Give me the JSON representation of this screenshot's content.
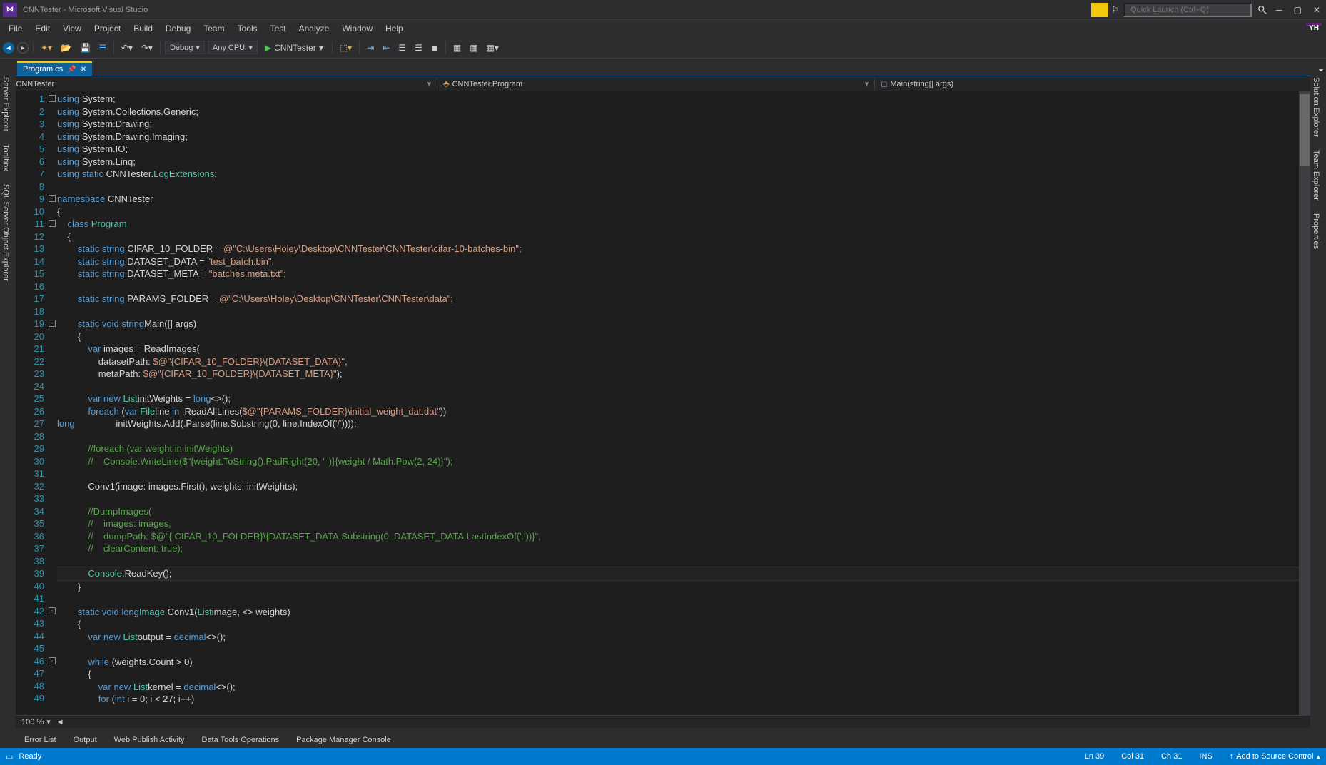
{
  "title": "CNNTester - Microsoft Visual Studio",
  "quick_launch_placeholder": "Quick Launch (Ctrl+Q)",
  "user_initials": "YH",
  "menu": [
    "File",
    "Edit",
    "View",
    "Project",
    "Build",
    "Debug",
    "Team",
    "Tools",
    "Test",
    "Analyze",
    "Window",
    "Help"
  ],
  "toolbar": {
    "config": "Debug",
    "platform": "Any CPU",
    "start_label": "CNNTester"
  },
  "tab": {
    "name": "Program.cs"
  },
  "nav": {
    "project": "CNNTester",
    "class": "CNNTester.Program",
    "member": "Main(string[] args)"
  },
  "side_left": [
    "Server Explorer",
    "Toolbox",
    "SQL Server Object Explorer"
  ],
  "side_right": [
    "Solution Explorer",
    "Team Explorer",
    "Properties"
  ],
  "zoom": "100 %",
  "bottom_tabs": [
    "Error List",
    "Output",
    "Web Publish Activity",
    "Data Tools Operations",
    "Package Manager Console"
  ],
  "status": {
    "ready": "Ready",
    "ln": "Ln 39",
    "col": "Col 31",
    "ch": "Ch 31",
    "ins": "INS",
    "src_control": "Add to Source Control"
  },
  "code": {
    "lines": 49,
    "current_line": 39,
    "l1": {
      "kw": "using",
      "ns": " System;"
    },
    "l2": {
      "kw": "using",
      "ns": " System.Collections.Generic;"
    },
    "l3": {
      "kw": "using",
      "ns": " System.Drawing;"
    },
    "l4": {
      "kw": "using",
      "ns": " System.Drawing.Imaging;"
    },
    "l5": {
      "kw": "using",
      "ns": " System.IO;"
    },
    "l6": {
      "kw": "using",
      "ns": " System.Linq;"
    },
    "l7": {
      "kw1": "using static",
      "ns": " CNNTester.",
      "t": "LogExtensions",
      "end": ";"
    },
    "l9": {
      "kw": "namespace",
      "ns": " CNNTester"
    },
    "l10": "{",
    "l11": {
      "kw": "    class ",
      "t": "Program"
    },
    "l12": "    {",
    "l13": {
      "kw": "        static string ",
      "id": "CIFAR_10_FOLDER = ",
      "s": "@\"C:\\Users\\Holey\\Desktop\\CNNTester\\CNNTester\\cifar-10-batches-bin\"",
      "end": ";"
    },
    "l14": {
      "kw": "        static string ",
      "id": "DATASET_DATA = ",
      "s": "\"test_batch.bin\"",
      "end": ";"
    },
    "l15": {
      "kw": "        static string ",
      "id": "DATASET_META = ",
      "s": "\"batches.meta.txt\"",
      "end": ";"
    },
    "l17": {
      "kw": "        static string ",
      "id": "PARAMS_FOLDER = ",
      "s": "@\"C:\\Users\\Holey\\Desktop\\CNNTester\\CNNTester\\data\"",
      "end": ";"
    },
    "l19": {
      "kw": "        static void ",
      "id": "Main(",
      "kw2": "string",
      "id2": "[] args)"
    },
    "l20": "        {",
    "l21": {
      "kw": "            var ",
      "id": "images = ReadImages("
    },
    "l22": {
      "id": "                datasetPath: ",
      "s": "$@\"{CIFAR_10_FOLDER}\\{DATASET_DATA}\"",
      "end": ","
    },
    "l23": {
      "id": "                metaPath: ",
      "s": "$@\"{CIFAR_10_FOLDER}\\{DATASET_META}\"",
      "end": ");"
    },
    "l25": {
      "kw": "            var ",
      "id": "initWeights = ",
      "kw2": "new ",
      "t": "List",
      "b": "<",
      "kw3": "long",
      "b2": ">();"
    },
    "l26": {
      "kw": "            foreach ",
      "p": "(",
      "kw2": "var ",
      "id": "line ",
      "kw3": "in ",
      "t": "File",
      "id2": ".ReadAllLines(",
      "s": "$@\"{PARAMS_FOLDER}\\initial_weight_dat.dat\"",
      "end": "))"
    },
    "l27": {
      "id": "                initWeights.Add(",
      "kw": "long",
      "id2": ".Parse(line.Substring(0, line.IndexOf(",
      "s": "'/'",
      "end": "))));"
    },
    "l29": "            //foreach (var weight in initWeights)",
    "l30": "            //    Console.WriteLine($\"{weight.ToString().PadRight(20, ' ')}{weight / Math.Pow(2, 24)}\");",
    "l32": "            Conv1(image: images.First(), weights: initWeights);",
    "l34": "            //DumpImages(",
    "l35": "            //    images: images,",
    "l36": "            //    dumpPath: $@\"{ CIFAR_10_FOLDER}\\{DATASET_DATA.Substring(0, DATASET_DATA.LastIndexOf('.'))}\",",
    "l37": "            //    clearContent: true);",
    "l39": {
      "t": "            Console",
      "id": ".ReadKey();"
    },
    "l40": "        }",
    "l42": {
      "kw": "        static void ",
      "id": "Conv1(",
      "t": "Image ",
      "id2": "image, ",
      "t2": "List",
      "b": "<",
      "kw2": "long",
      "b2": "> weights)"
    },
    "l43": "        {",
    "l44": {
      "kw": "            var ",
      "id": "output = ",
      "kw2": "new ",
      "t": "List",
      "b": "<",
      "kw3": "decimal",
      "b2": ">();"
    },
    "l46": {
      "kw": "            while ",
      "id": "(weights.Count > 0)"
    },
    "l47": "            {",
    "l48": {
      "kw": "                var ",
      "id": "kernel = ",
      "kw2": "new ",
      "t": "List",
      "b": "<",
      "kw3": "decimal",
      "b2": ">();"
    },
    "l49": {
      "kw": "                for ",
      "p": "(",
      "kw2": "int ",
      "id": "i = 0; i < 27; i++)"
    }
  }
}
